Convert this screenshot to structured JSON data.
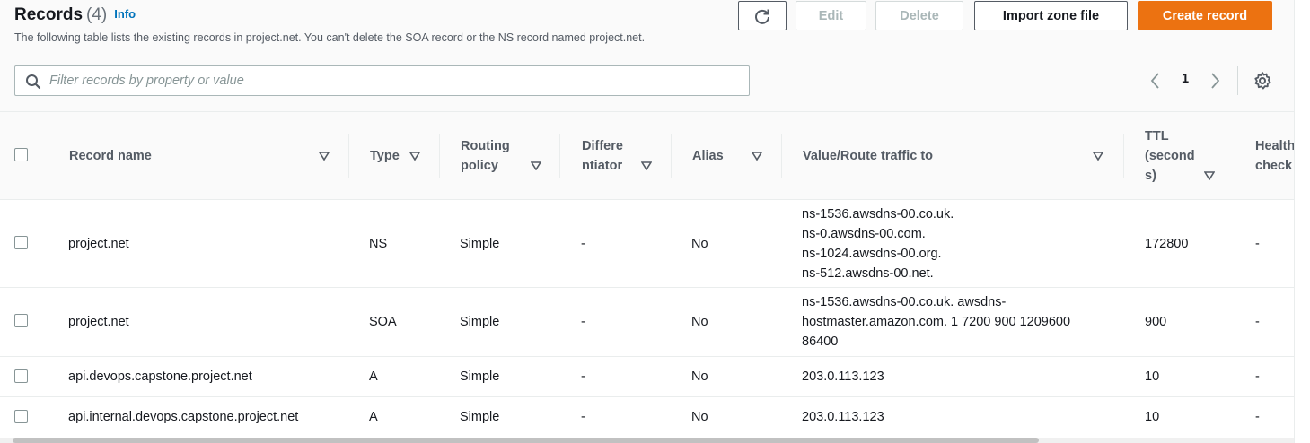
{
  "header": {
    "title": "Records",
    "count": "(4)",
    "info_link": "Info",
    "description": "The following table lists the existing records in project.net. You can't delete the SOA record or the NS record named project.net."
  },
  "toolbar": {
    "refresh_icon": "refresh-icon",
    "edit_label": "Edit",
    "delete_label": "Delete",
    "import_label": "Import zone file",
    "create_label": "Create record",
    "accent_color": "#ec7211"
  },
  "search": {
    "placeholder": "Filter records by property or value",
    "value": ""
  },
  "pagination": {
    "current_page": "1",
    "prev_icon": "chevron-left-icon",
    "next_icon": "chevron-right-icon",
    "settings_icon": "gear-icon"
  },
  "table": {
    "columns": [
      "Record name",
      "Type",
      "Routing policy",
      "Differe ntiator",
      "Alias",
      "Value/Route traffic to",
      "TTL (second s)",
      "Health check"
    ],
    "rows": [
      {
        "name": "project.net",
        "type": "NS",
        "routing": "Simple",
        "differentiator": "-",
        "alias": "No",
        "value_lines": [
          "ns-1536.awsdns-00.co.uk.",
          "ns-0.awsdns-00.com.",
          "ns-1024.awsdns-00.org.",
          "ns-512.awsdns-00.net."
        ],
        "ttl": "172800",
        "health": "-"
      },
      {
        "name": "project.net",
        "type": "SOA",
        "routing": "Simple",
        "differentiator": "-",
        "alias": "No",
        "value_lines": [
          "ns-1536.awsdns-00.co.uk. awsdns-",
          "hostmaster.amazon.com. 1 7200 900 1209600",
          "86400"
        ],
        "ttl": "900",
        "health": "-"
      },
      {
        "name": "api.devops.capstone.project.net",
        "type": "A",
        "routing": "Simple",
        "differentiator": "-",
        "alias": "No",
        "value_lines": [
          "203.0.113.123"
        ],
        "ttl": "10",
        "health": "-"
      },
      {
        "name": "api.internal.devops.capstone.project.net",
        "type": "A",
        "routing": "Simple",
        "differentiator": "-",
        "alias": "No",
        "value_lines": [
          "203.0.113.123"
        ],
        "ttl": "10",
        "health": "-"
      }
    ]
  }
}
